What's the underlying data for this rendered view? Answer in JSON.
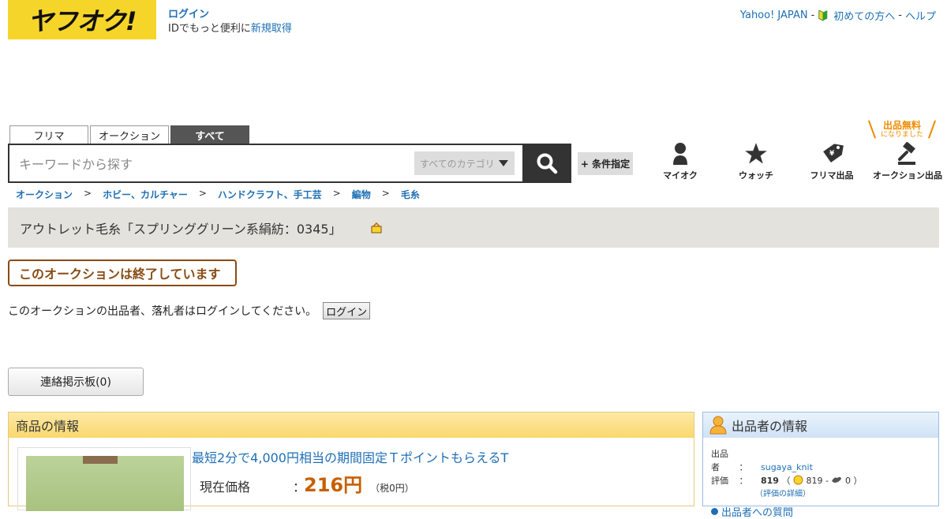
{
  "header": {
    "logo_text": "ヤフオク!",
    "login_label": "ログイン",
    "id_prompt": "IDでもっと便利に",
    "register_link": "新規取得",
    "top_links": {
      "yahoo_japan": "Yahoo! JAPAN",
      "beginners": "初めての方へ",
      "help": "ヘルプ",
      "sep": "-"
    }
  },
  "search": {
    "tabs": [
      {
        "label": "フリマ"
      },
      {
        "label": "オークション"
      },
      {
        "label": "すべて"
      }
    ],
    "placeholder": "キーワードから探す",
    "category": "すべてのカテゴリ",
    "conditions_label": "+ 条件指定"
  },
  "nav": {
    "my_auction": "マイオク",
    "watch": "ウォッチ",
    "flea_listing": "フリマ出品",
    "auction_listing": "オークション出品",
    "free_listing_big": "出品無料",
    "free_listing_small": "になりました"
  },
  "breadcrumb": [
    "オークション",
    "ホビー、カルチャー",
    "ハンドクラフト、手工芸",
    "編物",
    "毛糸"
  ],
  "breadcrumb_sep": ">",
  "item": {
    "title": "アウトレット毛糸「スプリンググリーン系絹紡：0345」",
    "ended_message": "このオークションは終了しています",
    "login_notice": "このオークションの出品者、落札者はログインしてください。",
    "login_button": "ログイン",
    "board_button": "連絡掲示板(0)",
    "panel_title": "商品の情報",
    "promo": "最短2分で4,000円相当の期間固定ＴポイントもらえるΤ",
    "price_label": "現在価格",
    "price_colon": "：",
    "price_value": "216円",
    "price_tax": "（税0円）"
  },
  "seller": {
    "panel_title": "出品者の情報",
    "seller_label": "出品者",
    "colon": "：",
    "seller_id": "sugaya_knit",
    "rating_label": "評価",
    "rating_total": "819",
    "rating_good": "819",
    "rating_dash": "-",
    "rating_bad": "0",
    "rating_open": "（",
    "rating_close": "）",
    "rating_detail": "（評価の詳細）",
    "links_partial": "出品者への質問"
  },
  "colors": {
    "logo_yellow": "#f6d52a",
    "link_blue": "#1e6fb5",
    "price_orange": "#c75f00",
    "ended_brown": "#8a4b12",
    "title_bar_bg": "#e3e2dc"
  }
}
